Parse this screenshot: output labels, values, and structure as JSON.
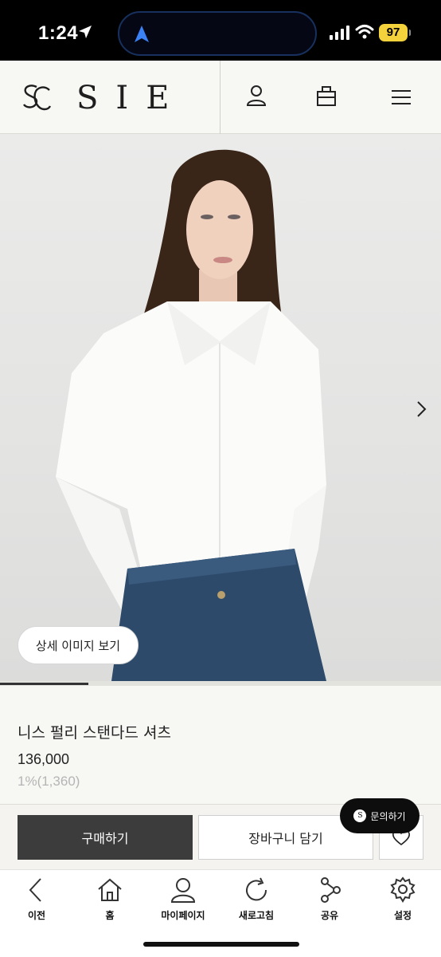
{
  "status_bar": {
    "time": "1:24",
    "battery": "97",
    "battery_color": "#f4d23b"
  },
  "header": {
    "brand": "SIE",
    "icons": [
      "account-icon",
      "shopping-bag-icon",
      "menu-icon"
    ]
  },
  "product_image": {
    "detail_button": "상세 이미지 보기",
    "next_icon": "chevron-right-icon",
    "gallery_progress": 0.2
  },
  "product": {
    "name": "니스 펄리 스탠다드 셔츠",
    "price": "136,000",
    "point": "1%(1,360)"
  },
  "actions": {
    "buy": "구매하기",
    "cart": "장바구니 담기",
    "wishlist_icon": "heart-icon",
    "inquiry": "문의하기"
  },
  "bottom_nav": {
    "items": [
      {
        "label": "이전",
        "icon": "back-icon"
      },
      {
        "label": "홈",
        "icon": "home-icon"
      },
      {
        "label": "마이페이지",
        "icon": "user-icon"
      },
      {
        "label": "새로고침",
        "icon": "refresh-icon"
      },
      {
        "label": "공유",
        "icon": "share-icon"
      },
      {
        "label": "설정",
        "icon": "settings-icon"
      }
    ]
  },
  "colors": {
    "buy_button": "#3c3c3c",
    "page_bg": "#f4f3ef"
  }
}
